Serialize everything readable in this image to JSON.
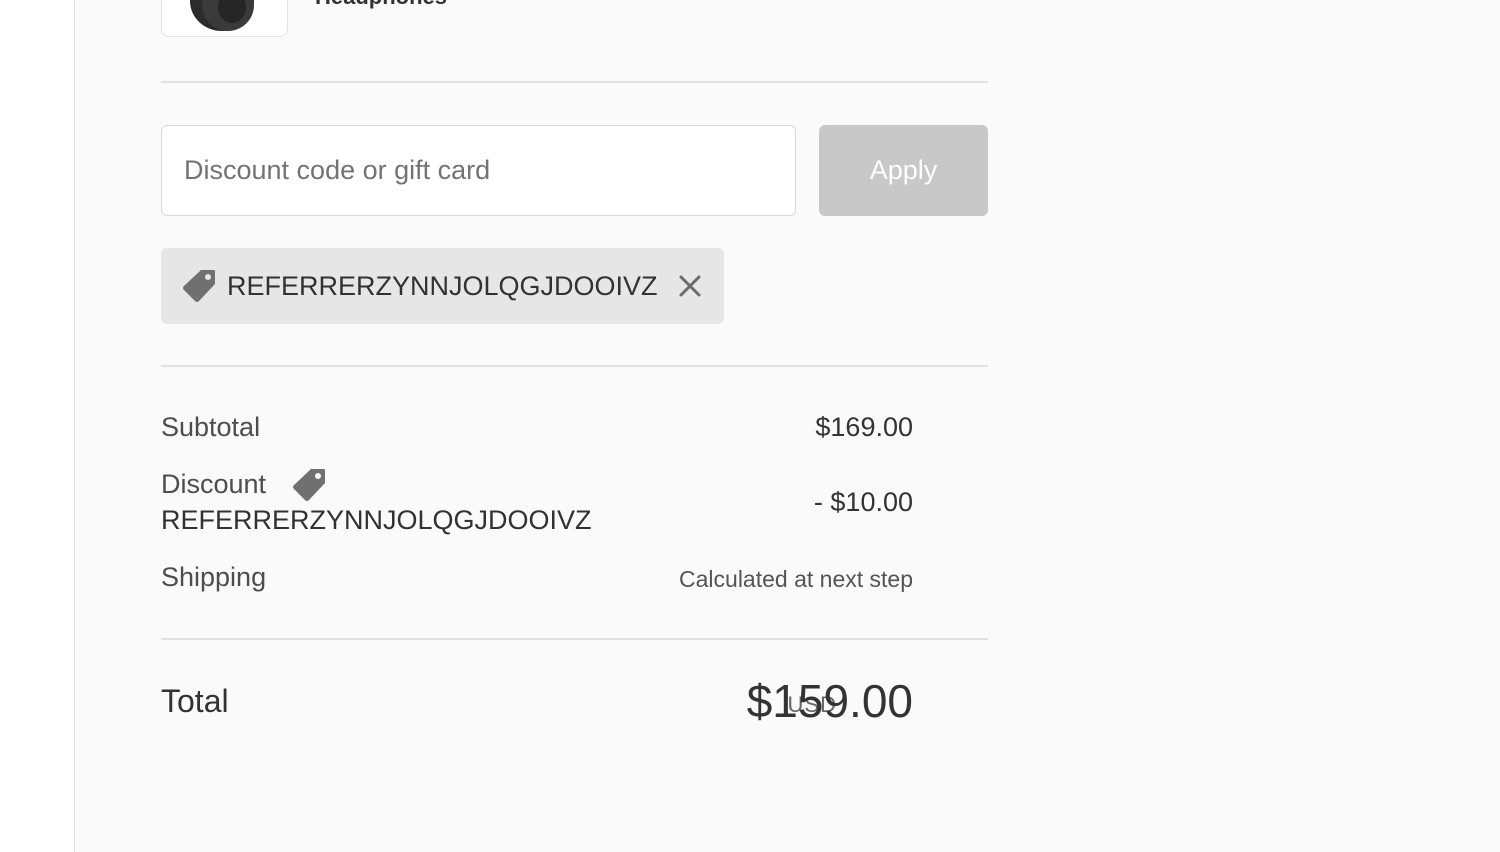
{
  "product": {
    "name": "Headphones",
    "image_icon": "headphones-product-image"
  },
  "discount": {
    "input_placeholder": "Discount code or gift card",
    "input_value": "",
    "apply_label": "Apply",
    "applied_code": "REFERRERZYNNJOLQGJDOOIVZ",
    "tag_icon": "tag-icon",
    "remove_icon": "close-icon"
  },
  "summary": {
    "subtotal_label": "Subtotal",
    "subtotal_value": "$169.00",
    "discount_label": "Discount",
    "discount_code": "REFERRERZYNNJOLQGJDOOIVZ",
    "discount_value": "- $10.00",
    "shipping_label": "Shipping",
    "shipping_value": "Calculated at next step",
    "total_label": "Total",
    "currency": "USD",
    "total_value": "$159.00"
  },
  "colors": {
    "summary_background": "#fafafa",
    "apply_button_disabled": "#c8c8c8",
    "chip_background": "#e6e6e6",
    "tag_icon": "#707070"
  }
}
